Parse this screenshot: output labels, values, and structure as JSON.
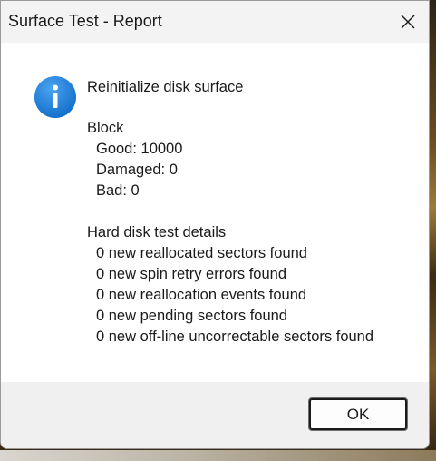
{
  "window": {
    "title": "Surface Test - Report",
    "close_icon": "close-icon"
  },
  "message": {
    "icon": "info-icon",
    "icon_color": "#1976d2",
    "heading": "Reinitialize disk surface",
    "block": {
      "label": "Block",
      "good": "Good: 10000",
      "damaged": "Damaged: 0",
      "bad": "Bad: 0"
    },
    "details": {
      "label": "Hard disk test details",
      "items": [
        "0 new reallocated sectors found",
        "0 new spin retry errors found",
        "0 new reallocation events found",
        "0 new pending sectors found",
        "0 new off-line uncorrectable sectors found"
      ]
    }
  },
  "buttons": {
    "ok_label": "OK"
  }
}
